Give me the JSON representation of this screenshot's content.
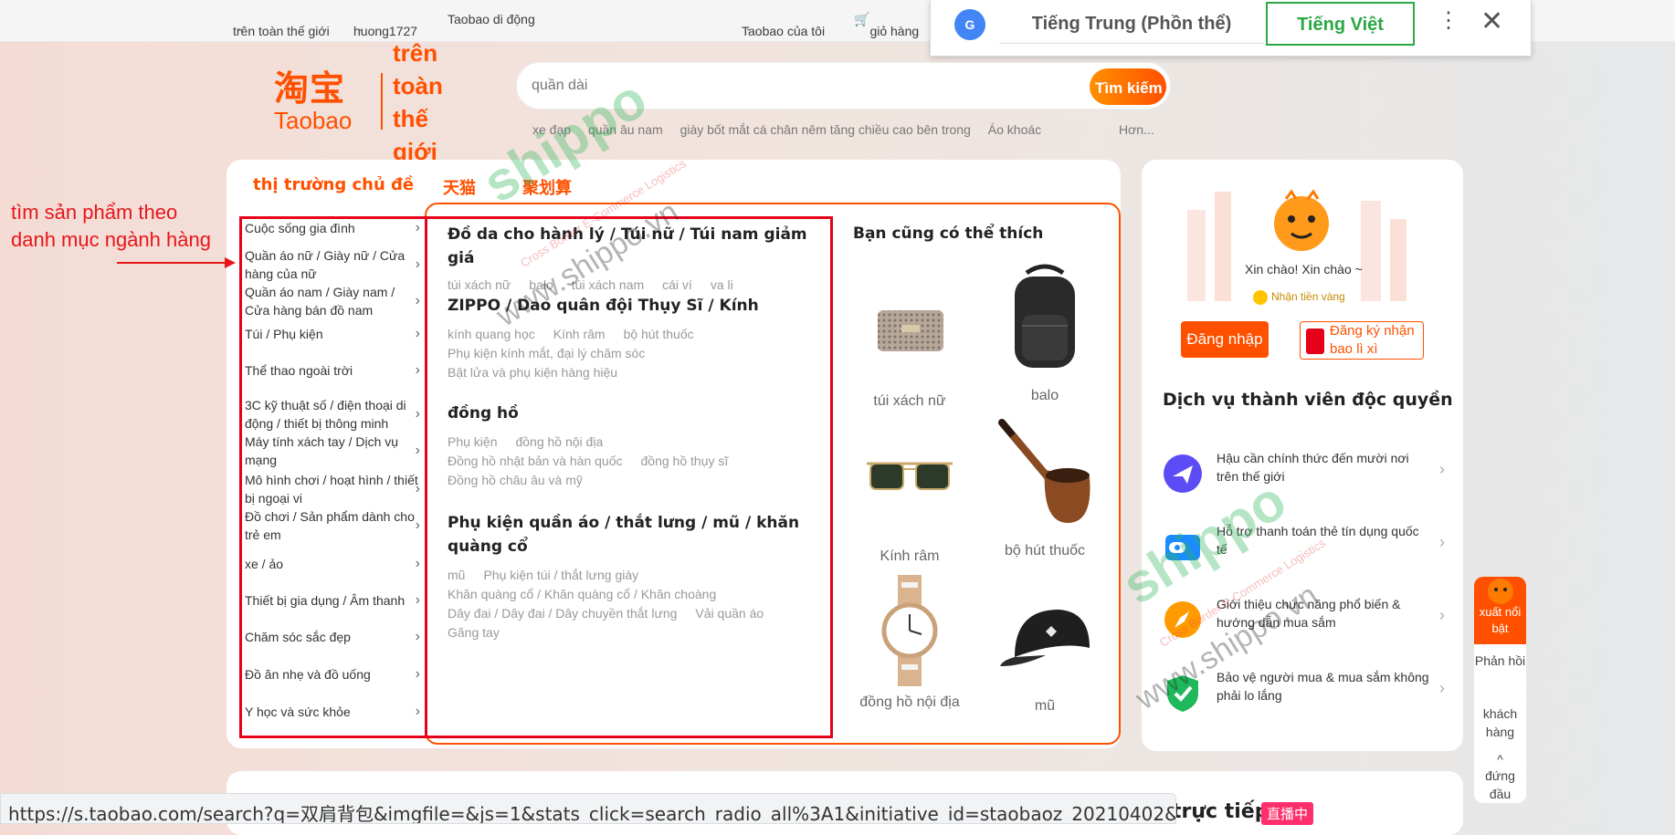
{
  "topbar": {
    "region": "trên toàn thế giới",
    "user": "huong1727",
    "mobile": "Taobao di động",
    "my_taobao": "Taobao của tôi",
    "cart": "giỏ hàng"
  },
  "logo": {
    "cn": "淘宝",
    "en": "Taobao",
    "region": "trên toàn thế giới"
  },
  "search": {
    "placeholder": "quần dài",
    "button": "Tìm kiếm"
  },
  "hotwords": [
    "xe đạp",
    "quần âu nam",
    "giày bốt mắt cá chân nêm tăng chiều cao bên trong",
    "Áo khoác"
  ],
  "hot_more": "Hơn...",
  "tabs": [
    "thị trường chủ đề",
    "天猫",
    "聚划算"
  ],
  "categories": [
    "Cuộc sống gia đình",
    "Quần áo nữ / Giày nữ / Cửa hàng của nữ",
    "Quần áo nam / Giày nam / Cửa hàng bán đồ nam",
    "Túi / Phụ kiện",
    "Thể thao ngoài trời",
    "3C kỹ thuật số / điện thoại di động / thiết bị thông minh",
    "Máy tính xách tay / Dịch vụ mạng",
    "Mô hình chơi / hoạt hình / thiết bị ngoại vi",
    "Đồ chơi / Sản phẩm dành cho trẻ em",
    "xe / ảo",
    "Thiết bị gia dụng / Âm thanh",
    "Chăm sóc sắc đẹp",
    "Đồ ăn nhẹ và đồ uống",
    "Y học và sức khỏe"
  ],
  "subcats": [
    {
      "title": "Đồ da cho hành lý / Túi nữ / Túi nam giảm giá",
      "lines": [
        [
          "túi xách nữ",
          "balo",
          "túi xách nam",
          "cái ví",
          "va li"
        ]
      ]
    },
    {
      "title": "ZIPPO / Dao quân đội Thụy Sĩ / Kính",
      "lines": [
        [
          "kính quang học",
          "Kính râm",
          "bộ hút thuốc"
        ],
        [
          "Phụ kiện kính mắt, đại lý chăm sóc"
        ],
        [
          "Bật lửa và phụ kiện hàng hiệu"
        ]
      ]
    },
    {
      "title": "đồng hồ",
      "lines": [
        [
          "Phụ kiện",
          "đồng hồ nội địa"
        ],
        [
          "Đồng hồ nhật bản và hàn quốc",
          "đồng hồ thụy sĩ"
        ],
        [
          "Đồng hồ châu âu và mỹ"
        ]
      ]
    },
    {
      "title": "Phụ kiện quần áo / thắt lưng / mũ / khăn quàng cổ",
      "lines": [
        [
          "mũ",
          "Phụ kiện túi / thắt lưng giày"
        ],
        [
          "Khăn quàng cổ / Khăn quàng cổ / Khăn choàng"
        ],
        [
          "Dây đai / Dây đai / Dây chuyền thắt lưng",
          "Vải quần áo"
        ],
        [
          "Găng tay"
        ]
      ]
    }
  ],
  "recommend": {
    "title": "Bạn cũng có thể thích",
    "items": [
      {
        "label": "túi xách nữ",
        "icon": "handbag-icon"
      },
      {
        "label": "balo",
        "icon": "backpack-icon"
      },
      {
        "label": "Kính râm",
        "icon": "sunglasses-icon"
      },
      {
        "label": "bộ hút thuốc",
        "icon": "pipe-icon"
      },
      {
        "label": "đồng hồ nội địa",
        "icon": "watch-icon"
      },
      {
        "label": "mũ",
        "icon": "cap-icon"
      }
    ]
  },
  "side": {
    "greeting": "Xin chào! Xin chào ~",
    "gold": "Nhận tiền vàng",
    "login": "Đăng nhập",
    "hongbao": "Đăng ký nhận bao lì xì",
    "service_title": "Dịch vụ thành viên độc quyền",
    "services": [
      {
        "text": "Hậu cần chính thức đến mười nơi trên thế giới",
        "icon": "plane-icon",
        "color": "#5b4cf5"
      },
      {
        "text": "Hỗ trợ thanh toán thẻ tín dụng quốc tế",
        "icon": "wallet-icon",
        "color": "#1a8cff"
      },
      {
        "text": "Giới thiệu chức năng phổ biến & hướng dẫn mua sắm",
        "icon": "compass-icon",
        "color": "#ff9a00"
      },
      {
        "text": "Bảo vệ người mua & mua sắm không phải lo lắng",
        "icon": "shield-icon",
        "color": "#1fb85a"
      }
    ]
  },
  "annotation": "tìm sản phẩm theo\ndanh mục ngành hàng",
  "bottom": {
    "live": "trực tiếp",
    "live_badge": "直播中"
  },
  "statusbar": "https://s.taobao.com/search?q=双肩背包&imgfile=&js=1&stats_click=search_radio_all%3A1&initiative_id=staobaoz_20210402&ie=utf8",
  "translate": {
    "source": "Tiếng Trung (Phồn thể)",
    "target": "Tiếng Việt"
  },
  "float_right": {
    "top": "xuất nổi bật",
    "items": [
      "Phản hồi",
      "khách hàng",
      "đứng đầu"
    ]
  },
  "watermark": {
    "brand": "shippo",
    "site": "www.shippo.vn",
    "tagline": "Cross Border E-Commerce Logistics"
  },
  "colors": {
    "brand_orange": "#ff5000",
    "annotation_red": "#e6001a",
    "translate_green": "#29a844"
  }
}
